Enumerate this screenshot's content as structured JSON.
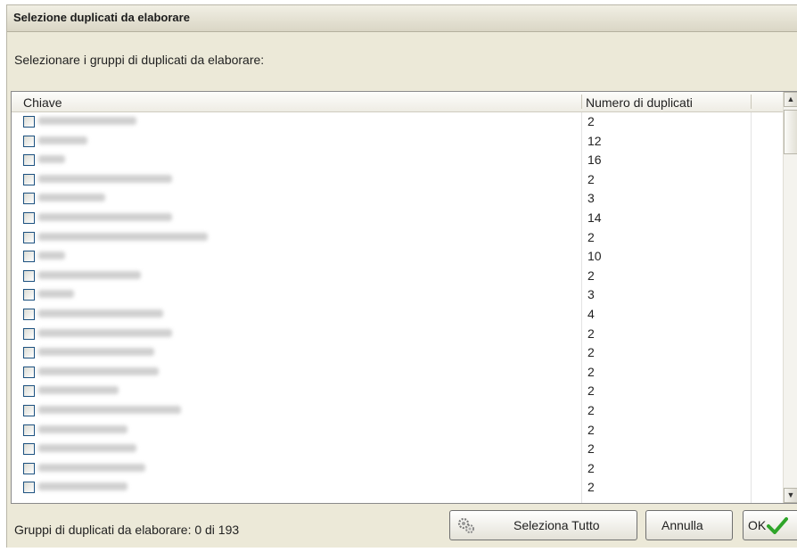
{
  "window": {
    "title": "Selezione duplicati da elaborare"
  },
  "instruction": "Selezionare i gruppi di duplicati da elaborare:",
  "table": {
    "columns": [
      "Chiave",
      "Numero di duplicati"
    ],
    "rows": [
      {
        "checked": false,
        "count": "2"
      },
      {
        "checked": false,
        "count": "12"
      },
      {
        "checked": false,
        "count": "16"
      },
      {
        "checked": false,
        "count": "2"
      },
      {
        "checked": false,
        "count": "3"
      },
      {
        "checked": false,
        "count": "14"
      },
      {
        "checked": false,
        "count": "2"
      },
      {
        "checked": false,
        "count": "10"
      },
      {
        "checked": false,
        "count": "2"
      },
      {
        "checked": false,
        "count": "3"
      },
      {
        "checked": false,
        "count": "4"
      },
      {
        "checked": false,
        "count": "2"
      },
      {
        "checked": false,
        "count": "2"
      },
      {
        "checked": false,
        "count": "2"
      },
      {
        "checked": false,
        "count": "2"
      },
      {
        "checked": false,
        "count": "2"
      },
      {
        "checked": false,
        "count": "2"
      },
      {
        "checked": false,
        "count": "2"
      },
      {
        "checked": false,
        "count": "2"
      },
      {
        "checked": false,
        "count": "2"
      }
    ]
  },
  "status": "Gruppi di duplicati da elaborare: 0 di 193",
  "buttons": {
    "select_all": "Seleziona Tutto",
    "cancel": "Annulla",
    "ok": "OK"
  },
  "icons": {
    "select_all": "gears-icon",
    "ok": "checkmark-icon"
  },
  "colors": {
    "ok_check": "#2fa52a"
  }
}
